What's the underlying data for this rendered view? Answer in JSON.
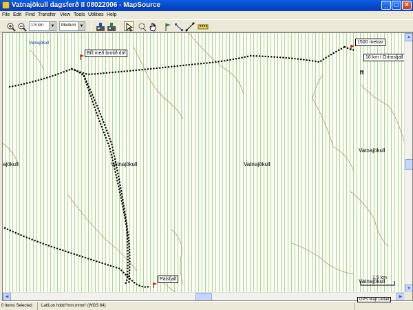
{
  "window": {
    "title": "Vatnajökull dagsferð II 08022006 - MapSource",
    "controls": {
      "minimize": "_",
      "maximize": "□",
      "close": "×"
    }
  },
  "menu": [
    "File",
    "Edit",
    "Find",
    "Transfer",
    "View",
    "Tools",
    "Utilities",
    "Help"
  ],
  "toolbar": {
    "scale_value": "1.5 km",
    "detail_value": "Medium",
    "icons": [
      "zoom-in-icon",
      "zoom-out-icon",
      "receive-from-device-icon",
      "send-to-device-icon",
      "select-tool-icon",
      "zoom-tool-icon",
      "hand-pan-icon",
      "waypoint-tool-icon",
      "route-tool-icon",
      "distance-tool-icon",
      "ruler-icon"
    ]
  },
  "map": {
    "labels": [
      {
        "text": "Vatnajökull",
        "style": "blue"
      },
      {
        "text": "Vatnajökull",
        "style": "normal"
      },
      {
        "text": "Vatnajökull",
        "style": "normal"
      },
      {
        "text": "Vatnajökull",
        "style": "normal"
      },
      {
        "text": "ajökull",
        "style": "normal"
      },
      {
        "text": "Vatnajökull",
        "style": "normal"
      }
    ],
    "waypoints": [
      {
        "name": "Bíll með brotið drif"
      },
      {
        "name": "1500 metrar"
      },
      {
        "name": "16 km í Grímsfjall"
      },
      {
        "name": "Pálsfjall"
      }
    ],
    "scale_label": "1.5 km",
    "colors": {
      "track": "#000000",
      "contour": "#b59a72",
      "stripe": "#a9d38e",
      "flag": "#e01010"
    }
  },
  "status": {
    "selection": "0 Items Selected",
    "coord_format": "Lat/Lon hddd°mm.mmm' (WGS 84)",
    "map_detail": "GPS Map Detail"
  }
}
